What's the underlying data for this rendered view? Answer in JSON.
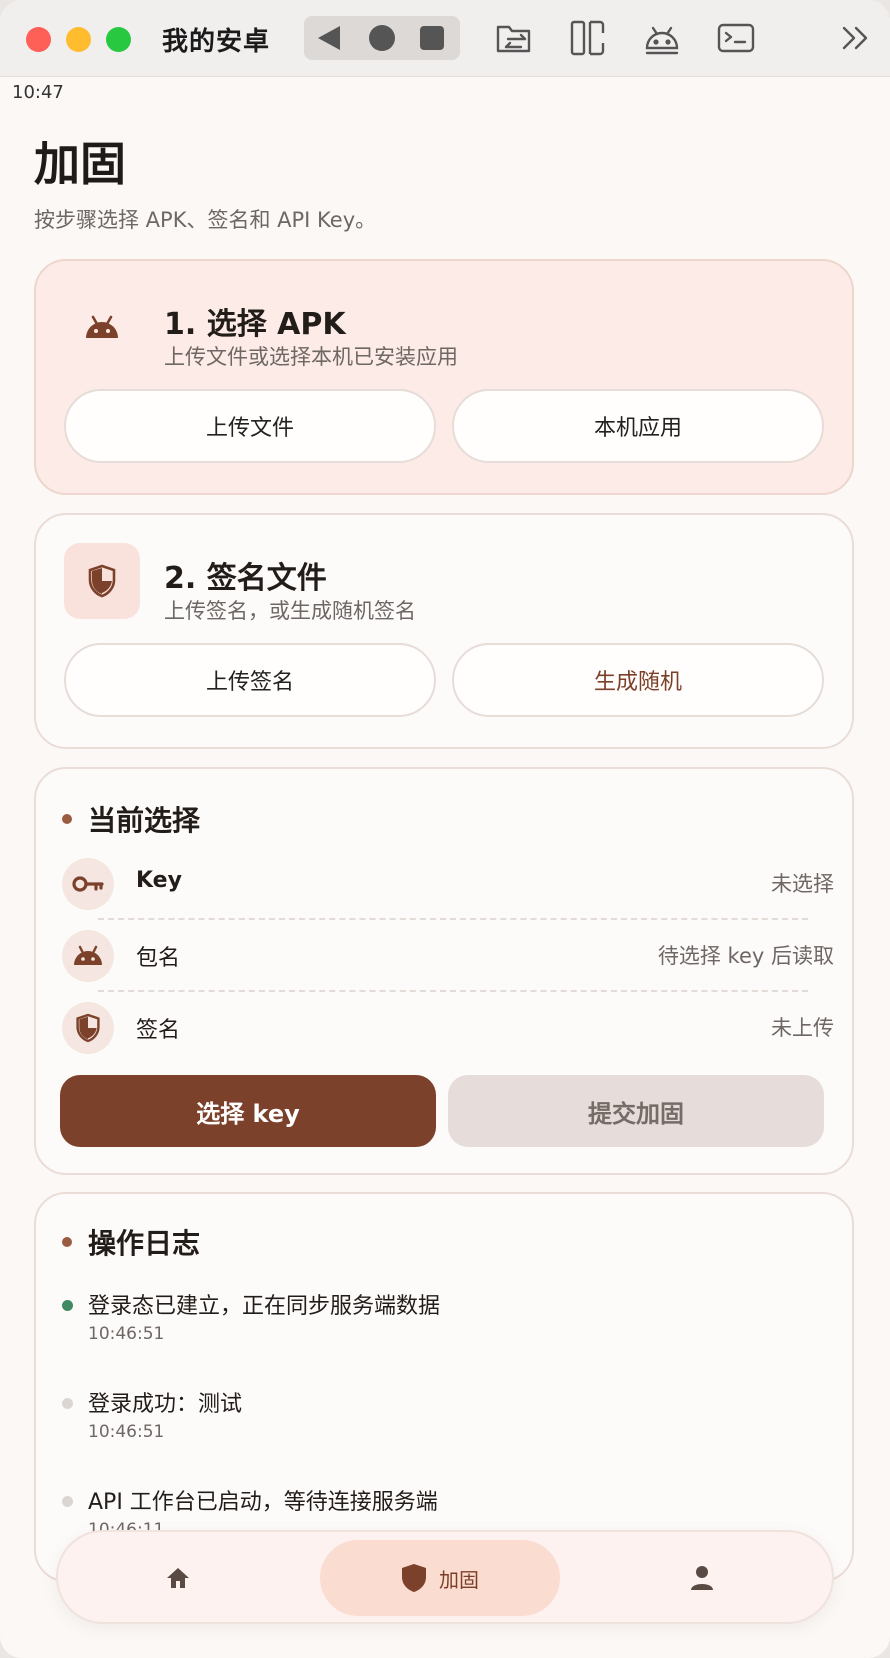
{
  "window": {
    "title": "我的安卓"
  },
  "status": {
    "time": "10:47"
  },
  "page": {
    "title": "加固",
    "subtitle": "按步骤选择 APK、签名和 API Key。"
  },
  "step1": {
    "title": "1. 选择 APK",
    "subtitle": "上传文件或选择本机已安装应用",
    "btn_upload": "上传文件",
    "btn_local": "本机应用"
  },
  "step2": {
    "title": "2. 签名文件",
    "subtitle": "上传签名，或生成随机签名",
    "btn_upload": "上传签名",
    "btn_random": "生成随机"
  },
  "selection": {
    "heading": "当前选择",
    "rows": [
      {
        "label": "Key",
        "value": "未选择",
        "icon": "key-icon"
      },
      {
        "label": "包名",
        "value": "待选择 key 后读取",
        "icon": "android-icon"
      },
      {
        "label": "签名",
        "value": "未上传",
        "icon": "shield-icon"
      }
    ],
    "btn_select_key": "选择 key",
    "btn_submit": "提交加固"
  },
  "log": {
    "heading": "操作日志",
    "items": [
      {
        "text": "登录态已建立，正在同步服务端数据",
        "time": "10:46:51",
        "dot_color": "#3f8a63"
      },
      {
        "text": "登录成功：测试",
        "time": "10:46:51",
        "dot_color": "#dcd6d3"
      },
      {
        "text": "API 工作台已启动，等待连接服务端",
        "time": "10:46:11",
        "dot_color": "#dcd6d3"
      }
    ]
  },
  "bottom_nav": {
    "items": [
      {
        "icon": "home-icon",
        "label": ""
      },
      {
        "icon": "shield-icon",
        "label": "加固",
        "active": true
      },
      {
        "icon": "person-icon",
        "label": ""
      }
    ]
  },
  "colors": {
    "accent": "#7c412b",
    "card_pink": "#fcebe6",
    "background": "#fbf8f6"
  }
}
